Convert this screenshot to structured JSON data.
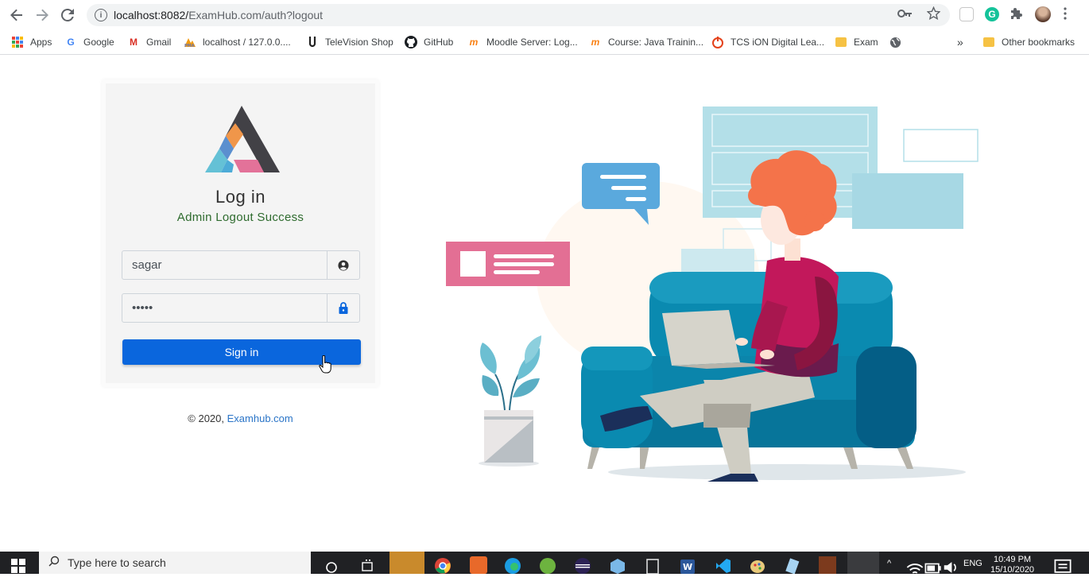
{
  "browser": {
    "url_host": "localhost:8082/",
    "url_path": "ExamHub.com/auth?logout",
    "bookmarks": [
      {
        "label": "Apps",
        "icon": "apps-grid-icon"
      },
      {
        "label": "Google",
        "icon": "google-icon"
      },
      {
        "label": "Gmail",
        "icon": "gmail-icon"
      },
      {
        "label": "localhost / 127.0.0....",
        "icon": "phpmyadmin-icon"
      },
      {
        "label": "TeleVision Shop",
        "icon": "tv-shop-icon"
      },
      {
        "label": "GitHub",
        "icon": "github-icon"
      },
      {
        "label": "Moodle Server: Log...",
        "icon": "moodle-icon"
      },
      {
        "label": "Course: Java Trainin...",
        "icon": "moodle-icon"
      },
      {
        "label": "TCS iON Digital Lea...",
        "icon": "tcs-ion-icon"
      },
      {
        "label": "Exam",
        "icon": "folder-icon"
      },
      {
        "label": "",
        "icon": "globe-icon"
      }
    ],
    "overflow": "»",
    "other_bookmarks": "Other bookmarks"
  },
  "login": {
    "title": "Log in",
    "message": "Admin Logout Success",
    "username_value": "sagar",
    "password_value": "•••••",
    "signin_label": "Sign in"
  },
  "footer": {
    "copyright": "© 2020, ",
    "link": "Examhub.com"
  },
  "taskbar": {
    "search_placeholder": "Type here to search",
    "language": "ENG",
    "time": "10:49 PM",
    "date": "15/10/2020"
  },
  "colors": {
    "primary": "#0a66dd",
    "success_text": "#2e6b2e",
    "sofa": "#0a8ab0",
    "shirt": "#c2185b",
    "hair": "#f4734a"
  }
}
